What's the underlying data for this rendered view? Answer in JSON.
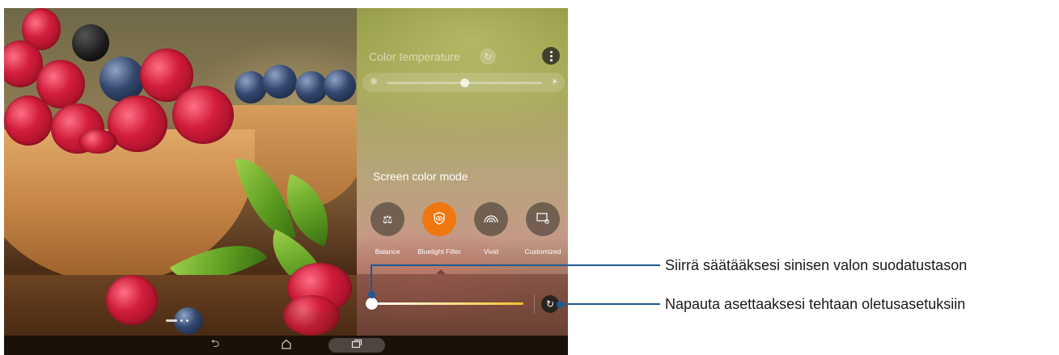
{
  "panel": {
    "color_temperature": {
      "title": "Color temperature",
      "reset_icon": "reset-icon",
      "more_icon": "more-vertical-icon",
      "cool_icon": "snowflake-icon",
      "warm_icon": "sun-icon",
      "level": 0.5
    },
    "screen_color_mode": {
      "title": "Screen color mode",
      "modes": [
        {
          "label": "Balance",
          "icon": "balance-scale-icon",
          "active": false
        },
        {
          "label": "Bluelight Filter",
          "icon": "eye-shield-icon",
          "active": true
        },
        {
          "label": "Vivid",
          "icon": "rainbow-icon",
          "active": false
        },
        {
          "label": "Customized",
          "icon": "custom-screen-icon",
          "active": false
        }
      ]
    },
    "bluelight_filter": {
      "level": 0.0,
      "gradient_from": "#ffffff",
      "gradient_to": "#f2c22a",
      "reset_icon": "reset-icon"
    }
  },
  "pager": {
    "pages": 3,
    "current": 1
  },
  "navbar": {
    "back_icon": "back-icon",
    "home_icon": "home-icon",
    "recents_icon": "recent-apps-icon"
  },
  "callouts": {
    "slider": "Siirrä säätääksesi sinisen valon suodatustason",
    "reset": "Napauta asettaaksesi tehtaan oletusasetuksiin"
  },
  "colors": {
    "accent": "#f0770f",
    "callout": "#1f5a93"
  }
}
